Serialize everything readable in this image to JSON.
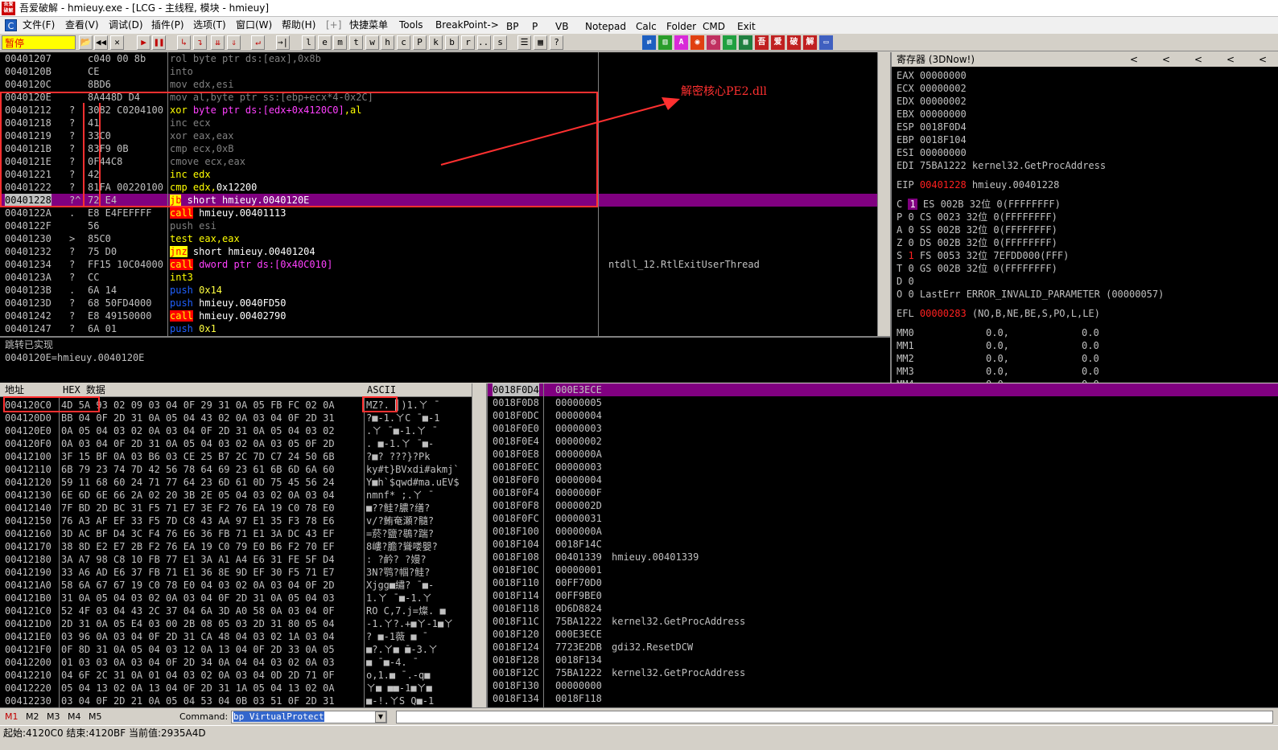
{
  "window": {
    "title": "吾爱破解 - hmieuy.exe - [LCG - 主线程, 模块 - hmieuy]",
    "icon_text": "吾爱破解"
  },
  "menu": {
    "c_icon": "C",
    "items": [
      "文件(F)",
      "查看(V)",
      "调试(D)",
      "插件(P)",
      "选项(T)",
      "窗口(W)",
      "帮助(H)",
      "[+]",
      "快捷菜单",
      "Tools",
      "BreakPoint->",
      "BP",
      "P",
      "VB",
      "Notepad",
      "Calc",
      "Folder",
      "CMD",
      "Exit"
    ]
  },
  "toolbar": {
    "status": "暂停",
    "buttons": [
      "📂",
      "◀◀",
      "✕",
      "▶",
      "❚❚",
      "↳",
      "↴",
      "⇊",
      "⇓",
      "↵",
      "→|"
    ],
    "letters": [
      "l",
      "e",
      "m",
      "t",
      "w",
      "h",
      "c",
      "P",
      "k",
      "b",
      "r",
      "...",
      "s"
    ],
    "misc": [
      "☰",
      "▦",
      "?"
    ],
    "right_icons": [
      "⇄",
      "▥",
      "A",
      "◉",
      "◎",
      "▤",
      "▦",
      "吾",
      "爱",
      "破",
      "解",
      "▭"
    ]
  },
  "cpu": {
    "rows": [
      {
        "addr": "00401207",
        "mark": "",
        "hex": "c040 00 8b",
        "parts": [
          {
            "t": "rol byte ptr ds:[eax],0x8b",
            "c": "grey"
          }
        ],
        "com": ""
      },
      {
        "addr": "0040120B",
        "mark": "",
        "hex": "CE",
        "parts": [
          {
            "t": "into",
            "c": "grey"
          }
        ],
        "com": ""
      },
      {
        "addr": "0040120C",
        "mark": "",
        "hex": "8BD6",
        "parts": [
          {
            "t": "mov edx,esi",
            "c": "grey"
          }
        ],
        "com": ""
      },
      {
        "addr": "0040120E",
        "mark": "",
        "hex": "8A448D D4",
        "parts": [
          {
            "t": "mov al,byte ptr ss:[ebp+ecx*4-0x2C]",
            "c": "grey"
          }
        ],
        "com": ""
      },
      {
        "addr": "00401212",
        "mark": "?",
        "hex": "3082 C0204100",
        "parts": [
          {
            "t": "xor",
            "c": "kw"
          },
          {
            "t": " byte ptr ds:[edx+0x4120C0]",
            "c": "mag"
          },
          {
            "t": ",al",
            "c": "kw"
          }
        ],
        "com": ""
      },
      {
        "addr": "00401218",
        "mark": "?",
        "hex": "41",
        "parts": [
          {
            "t": "inc ecx",
            "c": "grey"
          }
        ],
        "com": ""
      },
      {
        "addr": "00401219",
        "mark": "?",
        "hex": "33C0",
        "parts": [
          {
            "t": "xor eax,eax",
            "c": "grey"
          }
        ],
        "com": ""
      },
      {
        "addr": "0040121B",
        "mark": "?",
        "hex": "83F9 0B",
        "parts": [
          {
            "t": "cmp ecx,0xB",
            "c": "grey"
          }
        ],
        "com": ""
      },
      {
        "addr": "0040121E",
        "mark": "?",
        "hex": "0F44C8",
        "parts": [
          {
            "t": "cmove ecx,eax",
            "c": "grey"
          }
        ],
        "com": ""
      },
      {
        "addr": "00401221",
        "mark": "?",
        "hex": "42",
        "parts": [
          {
            "t": "inc",
            "c": "kw"
          },
          {
            "t": " edx",
            "c": "kw"
          }
        ],
        "com": ""
      },
      {
        "addr": "00401222",
        "mark": "?",
        "hex": "81FA 00220100",
        "parts": [
          {
            "t": "cmp",
            "c": "kw"
          },
          {
            "t": " edx,",
            "c": "kw"
          },
          {
            "t": "0x12200",
            "c": "white"
          }
        ],
        "com": ""
      },
      {
        "addr": "00401228",
        "mark": "?^",
        "hex": "72 E4",
        "parts": [
          {
            "t": "jb",
            "c": "kw-jmp"
          },
          {
            "t": " short hmieuy.0040120E",
            "c": "white"
          }
        ],
        "com": "",
        "sel": true
      },
      {
        "addr": "0040122A",
        "mark": ".",
        "hex": "E8 E4FEFFFF",
        "parts": [
          {
            "t": "call",
            "c": "kw-red"
          },
          {
            "t": " hmieuy.00401113",
            "c": "white"
          }
        ],
        "com": ""
      },
      {
        "addr": "0040122F",
        "mark": "",
        "hex": "56",
        "parts": [
          {
            "t": "push esi",
            "c": "grey"
          }
        ],
        "com": ""
      },
      {
        "addr": "00401230",
        "mark": ">",
        "hex": "85C0",
        "parts": [
          {
            "t": "test",
            "c": "kw"
          },
          {
            "t": " eax,eax",
            "c": "kw"
          }
        ],
        "com": ""
      },
      {
        "addr": "00401232",
        "mark": "?",
        "hex": "75 D0",
        "parts": [
          {
            "t": "jnz",
            "c": "kw-jmp"
          },
          {
            "t": " short hmieuy.00401204",
            "c": "white"
          }
        ],
        "com": ""
      },
      {
        "addr": "00401234",
        "mark": "?",
        "hex": "FF15 10C04000",
        "parts": [
          {
            "t": "call",
            "c": "kw-red"
          },
          {
            "t": " dword ptr ds:[0x40C010]",
            "c": "mag"
          }
        ],
        "com": "ntdll_12.RtlExitUserThread"
      },
      {
        "addr": "0040123A",
        "mark": "?",
        "hex": "CC",
        "parts": [
          {
            "t": "int3",
            "c": "kw"
          }
        ],
        "com": ""
      },
      {
        "addr": "0040123B",
        "mark": ".",
        "hex": "6A 14",
        "parts": [
          {
            "t": "push",
            "c": "kw-blue"
          },
          {
            "t": " 0x14",
            "c": "num"
          }
        ],
        "com": ""
      },
      {
        "addr": "0040123D",
        "mark": "?",
        "hex": "68 50FD4000",
        "parts": [
          {
            "t": "push",
            "c": "kw-blue"
          },
          {
            "t": " hmieuy.0040FD50",
            "c": "white"
          }
        ],
        "com": ""
      },
      {
        "addr": "00401242",
        "mark": "?",
        "hex": "E8 49150000",
        "parts": [
          {
            "t": "call",
            "c": "kw-red"
          },
          {
            "t": " hmieuy.00402790",
            "c": "white"
          }
        ],
        "com": ""
      },
      {
        "addr": "00401247",
        "mark": "?",
        "hex": "6A 01",
        "parts": [
          {
            "t": "push",
            "c": "kw-blue"
          },
          {
            "t": " 0x1",
            "c": "num"
          }
        ],
        "com": ""
      }
    ]
  },
  "info": {
    "line1": "跳转已实现",
    "line2": "0040120E=hmieuy.0040120E"
  },
  "registers": {
    "title": "寄存器 (3DNow!)",
    "arrows": [
      "<",
      "<",
      "<",
      "<",
      "<"
    ],
    "gp": [
      {
        "name": "EAX",
        "val": "00000000",
        "com": ""
      },
      {
        "name": "ECX",
        "val": "00000002",
        "com": ""
      },
      {
        "name": "EDX",
        "val": "00000002",
        "com": ""
      },
      {
        "name": "EBX",
        "val": "00000000",
        "com": ""
      },
      {
        "name": "ESP",
        "val": "0018F0D4",
        "com": ""
      },
      {
        "name": "EBP",
        "val": "0018F104",
        "com": ""
      },
      {
        "name": "ESI",
        "val": "00000000",
        "com": ""
      },
      {
        "name": "EDI",
        "val": "75BA1222",
        "com": "kernel32.GetProcAddress"
      }
    ],
    "eip": {
      "name": "EIP",
      "val": "00401228",
      "com": "hmieuy.00401228"
    },
    "flags": [
      {
        "f": "C",
        "v": "1",
        "seg": "ES",
        "sv": "002B",
        "bits": "32位",
        "base": "0(FFFFFFFF)",
        "box": true,
        "red": false
      },
      {
        "f": "P",
        "v": "0",
        "seg": "CS",
        "sv": "0023",
        "bits": "32位",
        "base": "0(FFFFFFFF)",
        "box": false,
        "red": false
      },
      {
        "f": "A",
        "v": "0",
        "seg": "SS",
        "sv": "002B",
        "bits": "32位",
        "base": "0(FFFFFFFF)",
        "box": false,
        "red": false
      },
      {
        "f": "Z",
        "v": "0",
        "seg": "DS",
        "sv": "002B",
        "bits": "32位",
        "base": "0(FFFFFFFF)",
        "box": false,
        "red": false
      },
      {
        "f": "S",
        "v": "1",
        "seg": "FS",
        "sv": "0053",
        "bits": "32位",
        "base": "7EFDD000(FFF)",
        "box": false,
        "red": true
      },
      {
        "f": "T",
        "v": "0",
        "seg": "GS",
        "sv": "002B",
        "bits": "32位",
        "base": "0(FFFFFFFF)",
        "box": false,
        "red": false
      }
    ],
    "d_flag": "D 0",
    "o_flag": "O 0",
    "lasterr": "LastErr ERROR_INVALID_PARAMETER (00000057)",
    "efl_name": "EFL",
    "efl_val": "00000283",
    "efl_desc": "(NO,B,NE,BE,S,PO,L,LE)",
    "mmx": [
      {
        "name": "MM0",
        "a": "0.0,",
        "b": "0.0"
      },
      {
        "name": "MM1",
        "a": "0.0,",
        "b": "0.0"
      },
      {
        "name": "MM2",
        "a": "0.0,",
        "b": "0.0"
      },
      {
        "name": "MM3",
        "a": "0.0,",
        "b": "0.0"
      },
      {
        "name": "MM4",
        "a": "0.0",
        "b": "0.0"
      }
    ]
  },
  "dump": {
    "col_addr": "地址",
    "col_hex": "HEX 数据",
    "col_ascii": "ASCII",
    "rows": [
      {
        "addr": "004120C0",
        "hex": "4D 5A 93 02 09 03 04 0F 29 31 0A 05 FB FC 02 0A",
        "ascii": "MZ?.  ▌)1.ㄚ ̄"
      },
      {
        "addr": "004120D0",
        "hex": "BB 04 0F 2D 31 0A 05 04 43 02 0A 03 04 0F 2D 31",
        "ascii": "?■-1.ㄚC ̄ ■-1"
      },
      {
        "addr": "004120E0",
        "hex": "0A 05 04 03 02 0A 03 04 0F 2D 31 0A 05 04 03 02",
        "ascii": ".ㄚ ̄ ■-1.ㄚ ̄"
      },
      {
        "addr": "004120F0",
        "hex": "0A 03 04 0F 2D 31 0A 05 04 03 02 0A 03 05 0F 2D",
        "ascii": ". ■-1.ㄚ ̄ ■-"
      },
      {
        "addr": "00412100",
        "hex": "3F 15 BF 0A 03 B6 03 CE 25 B7 2C 7D C7 24 50 6B",
        "ascii": "?■? ???}?Pk"
      },
      {
        "addr": "00412110",
        "hex": "6B 79 23 74 7D 42 56 78 64 69 23 61 6B 6D 6A 60",
        "ascii": "ky#t}BVxdi#akmj`"
      },
      {
        "addr": "00412120",
        "hex": "59 11 68 60 24 71 77 64 23 6D 61 0D 75 45 56 24",
        "ascii": "Y■h`$qwd#ma.uEV$"
      },
      {
        "addr": "00412130",
        "hex": "6E 6D 6E 66 2A 02 20 3B 2E 05 04 03 02 0A 03 04",
        "ascii": "nmnf* ;.ㄚ ̄"
      },
      {
        "addr": "00412140",
        "hex": "7F BD 2D BC 31 F5 71 E7 3E F2 76 EA 19 C0 78 E0",
        "ascii": "■??鲑?膿?缮?"
      },
      {
        "addr": "00412150",
        "hex": "76 A3 AF EF 33 F5 7D C8 43 AA 97 E1 35 F3 78 E6",
        "ascii": "v/?鲔奄瀬?髓?"
      },
      {
        "addr": "00412160",
        "hex": "3D AC BF D4 3C F4 76 E6 36 FB 71 E1 3A DC 43 EF",
        "ascii": "=菸?鹽?鶡?踹?"
      },
      {
        "addr": "00412170",
        "hex": "38 8D E2 E7 2B F2 76 EA 19 C0 79 E0 B6 F2 70 EF",
        "ascii": "8嶁?膽?聳喽嬰?"
      },
      {
        "addr": "00412180",
        "hex": "3A A7 98 C8 10 FB 77 E1 3A A1 A4 E6 31 FE 5F D4",
        "ascii": ": ?鹶? ?嫚?"
      },
      {
        "addr": "00412190",
        "hex": "33 A6 AD E6 37 FB 71 E1 36 8E 9D EF 30 F5 71 E7",
        "ascii": "3N?鹗?帼?鲑?"
      },
      {
        "addr": "004121A0",
        "hex": "58 6A 67 67 19 C0 78 E0 04 03 02 0A 03 04 0F 2D",
        "ascii": "Xjgg■繡? ̄ ■-"
      },
      {
        "addr": "004121B0",
        "hex": "31 0A 05 04 03 02 0A 03 04 0F 2D 31 0A 05 04 03",
        "ascii": "1.ㄚ ̄ ■-1.ㄚ"
      },
      {
        "addr": "004121C0",
        "hex": "52 4F 03 04 43 2C 37 04 6A 3D A0 58 0A 03 04 0F",
        "ascii": "RO C,7.j=燦. ■"
      },
      {
        "addr": "004121D0",
        "hex": "2D 31 0A 05 E4 03 00 2B 08 05 03 2D 31 80 05 04",
        "ascii": "-1.ㄚ?.+■ㄚ-1■ㄚ"
      },
      {
        "addr": "004121E0",
        "hex": "03 96 0A 03 04 0F 2D 31 CA 48 04 03 02 1A 03 04",
        "ascii": " ? ■-1薇 ■ ̄"
      },
      {
        "addr": "004121F0",
        "hex": "0F 8D 31 0A 05 04 03 12 0A 13 04 0F 2D 33 0A 05",
        "ascii": "■?.ㄚ■ ̄■-3.ㄚ"
      },
      {
        "addr": "00412200",
        "hex": "01 03 03 0A 03 04 0F 2D 34 0A 04 04 03 02 0A 03",
        "ascii": "■ ̄ ■-4. ̄"
      },
      {
        "addr": "00412210",
        "hex": "04 6F 2C 31 0A 01 04 03 02 0A 03 04 0D 2D 71 0F",
        "ascii": " o,1.■ ̄ .-q■"
      },
      {
        "addr": "00412220",
        "hex": "05 04 13 02 0A 13 04 0F 2D 31 1A 05 04 13 02 0A",
        "ascii": "ㄚ■ ■■-1■ㄚ■"
      },
      {
        "addr": "00412230",
        "hex": "03 04 0F 2D 21 0A 05 04 53 04 0B 03 51 0F 2D 31",
        "ascii": " ■-!.ㄚS  Q■-1"
      }
    ]
  },
  "stack": {
    "rows": [
      {
        "addr": "0018F0D4",
        "val": "000E3ECE",
        "com": "",
        "sel": true
      },
      {
        "addr": "0018F0D8",
        "val": "00000005",
        "com": ""
      },
      {
        "addr": "0018F0DC",
        "val": "00000004",
        "com": ""
      },
      {
        "addr": "0018F0E0",
        "val": "00000003",
        "com": ""
      },
      {
        "addr": "0018F0E4",
        "val": "00000002",
        "com": ""
      },
      {
        "addr": "0018F0E8",
        "val": "0000000A",
        "com": ""
      },
      {
        "addr": "0018F0EC",
        "val": "00000003",
        "com": ""
      },
      {
        "addr": "0018F0F0",
        "val": "00000004",
        "com": ""
      },
      {
        "addr": "0018F0F4",
        "val": "0000000F",
        "com": ""
      },
      {
        "addr": "0018F0F8",
        "val": "0000002D",
        "com": ""
      },
      {
        "addr": "0018F0FC",
        "val": "00000031",
        "com": ""
      },
      {
        "addr": "0018F100",
        "val": "0000000A",
        "com": ""
      },
      {
        "addr": "0018F104",
        "val": "0018F14C",
        "com": ""
      },
      {
        "addr": "0018F108",
        "val": "00401339",
        "com": "hmieuy.00401339"
      },
      {
        "addr": "0018F10C",
        "val": "00000001",
        "com": ""
      },
      {
        "addr": "0018F110",
        "val": "00FF70D0",
        "com": ""
      },
      {
        "addr": "0018F114",
        "val": "00FF9BE0",
        "com": ""
      },
      {
        "addr": "0018F118",
        "val": "0D6D8824",
        "com": ""
      },
      {
        "addr": "0018F11C",
        "val": "75BA1222",
        "com": "kernel32.GetProcAddress"
      },
      {
        "addr": "0018F120",
        "val": "000E3ECE",
        "com": ""
      },
      {
        "addr": "0018F124",
        "val": "7723E2DB",
        "com": "gdi32.ResetDCW"
      },
      {
        "addr": "0018F128",
        "val": "0018F134",
        "com": ""
      },
      {
        "addr": "0018F12C",
        "val": "75BA1222",
        "com": "kernel32.GetProcAddress"
      },
      {
        "addr": "0018F130",
        "val": "00000000",
        "com": ""
      },
      {
        "addr": "0018F134",
        "val": "0018F118",
        "com": ""
      }
    ]
  },
  "cmdbar": {
    "markers": [
      "M1",
      "M2",
      "M3",
      "M4",
      "M5"
    ],
    "label": "Command:",
    "value": "bp VirtualProtect",
    "drop": "▼"
  },
  "status": {
    "text": "起始:4120C0 结束:4120BF 当前值:2935A4D"
  },
  "annotation": {
    "text": "解密核心PE2.dll",
    "color": "#ff3030"
  },
  "colors": {
    "selection": "#800080",
    "highlight_red": "#ff0000",
    "pause_bg": "#ffff00"
  }
}
